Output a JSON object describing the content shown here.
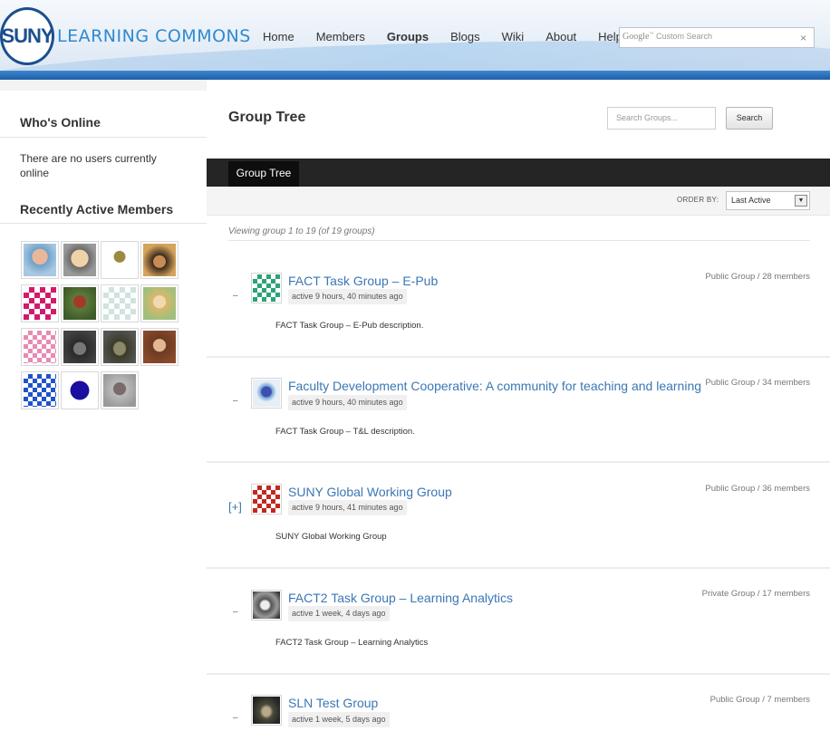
{
  "header": {
    "logo_mark": "SUNY",
    "logo_text": "LEARNING COMMONS",
    "nav": [
      "Home",
      "Members",
      "Groups",
      "Blogs",
      "Wiki",
      "About",
      "Help"
    ],
    "active_nav": "Groups",
    "search_brand": "Google",
    "search_placeholder": "Custom Search",
    "search_clear": "×"
  },
  "sidebar": {
    "whos_online_title": "Who's Online",
    "whos_online_text": "There are no users currently online",
    "recent_title": "Recently Active Members"
  },
  "main": {
    "title": "Group Tree",
    "search_placeholder": "Search Groups...",
    "search_button": "Search",
    "tab": "Group Tree",
    "order_label": "ORDER BY:",
    "order_value": "Last Active",
    "viewing": "Viewing group 1 to 19 (of 19 groups)",
    "groups": [
      {
        "title": "FACT Task Group – E-Pub",
        "active": "active 9 hours, 40 minutes ago",
        "meta": "Public Group / 28 members",
        "desc": "FACT Task Group – E-Pub description.",
        "toggle": "–"
      },
      {
        "title": "Faculty Development Cooperative: A community for teaching and learning",
        "active": "active 9 hours, 40 minutes ago",
        "meta": "Public Group / 34 members",
        "desc": "FACT Task Group – T&L description.",
        "toggle": "–"
      },
      {
        "title": "SUNY Global Working Group",
        "active": "active 9 hours, 41 minutes ago",
        "meta": "Public Group / 36 members",
        "desc": "SUNY Global Working Group",
        "toggle": "[+]"
      },
      {
        "title": "FACT2 Task Group – Learning Analytics",
        "active": "active 1 week, 4 days ago",
        "meta": "Private Group / 17 members",
        "desc": "FACT2 Task Group – Learning Analytics",
        "toggle": "–"
      },
      {
        "title": "SLN Test Group",
        "active": "active 1 week, 5 days ago",
        "meta": "Public Group / 7 members",
        "desc": "",
        "toggle": "–"
      }
    ]
  },
  "colors": {
    "link": "#3a77b5",
    "tabbar": "#252525",
    "brand": "#2f8ad0"
  }
}
